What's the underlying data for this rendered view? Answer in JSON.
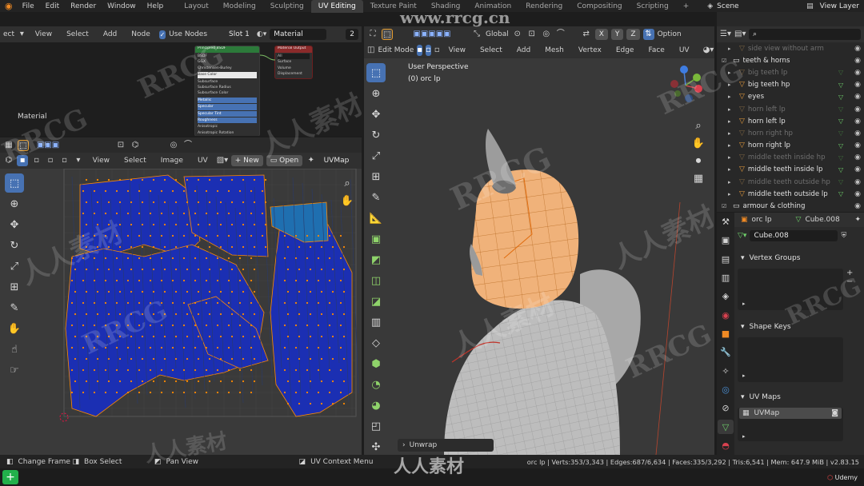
{
  "menubar": {
    "menus": [
      "File",
      "Edit",
      "Render",
      "Window",
      "Help"
    ],
    "workspaces": [
      "Layout",
      "Modeling",
      "Sculpting",
      "UV Editing",
      "Texture Paint",
      "Shading",
      "Animation",
      "Rendering",
      "Compositing",
      "Scripting"
    ],
    "active_workspace": "UV Editing",
    "add_tab": "+",
    "scene": "Scene",
    "view_layer": "View Layer"
  },
  "node_editor": {
    "menus": [
      "ect",
      "View",
      "Select",
      "Add",
      "Node"
    ],
    "use_nodes_label": "Use Nodes",
    "slot": "Slot 1",
    "material": "Material",
    "material_users": "2",
    "frame_label": "Material",
    "bsdf_title": "Principled BSDF",
    "output_title": "Material Output",
    "bsdf_rows": [
      "BSDF",
      "GGX",
      "Christensen-Burley",
      "Base Color",
      "Subsurface",
      "Subsurface Radius",
      "Subsurface Color",
      "Metallic",
      "Specular",
      "Specular Tint",
      "Roughness",
      "Anisotropic",
      "Anisotropic Rotation"
    ],
    "output_rows": [
      "All",
      "Surface",
      "Volume",
      "Displacement"
    ]
  },
  "uv_editor": {
    "menus": [
      "View",
      "Select",
      "Image",
      "UV"
    ],
    "new_label": "New",
    "open_label": "Open",
    "uvmap": "UVMap"
  },
  "viewport": {
    "mode": "Edit Mode",
    "menus": [
      "View",
      "Select",
      "Add",
      "Mesh",
      "Vertex",
      "Edge",
      "Face",
      "UV"
    ],
    "orientation": "Global",
    "options_label": "Option",
    "perspective": "User Perspective",
    "object_label": "(0) orc lp",
    "last_op": "Unwrap",
    "axes": [
      "X",
      "Y",
      "Z"
    ]
  },
  "outliner": {
    "search_placeholder": "",
    "rows": [
      {
        "name": "side view without arm",
        "dim": true,
        "type": "image"
      },
      {
        "name": "teeth & horns",
        "dim": false,
        "type": "collection"
      },
      {
        "name": "big teeth lp",
        "dim": true,
        "type": "mesh"
      },
      {
        "name": "big teeth hp",
        "dim": false,
        "type": "mesh"
      },
      {
        "name": "eyes",
        "dim": false,
        "type": "mesh"
      },
      {
        "name": "horn left lp",
        "dim": true,
        "type": "mesh"
      },
      {
        "name": "horn left lp",
        "dim": false,
        "type": "mesh"
      },
      {
        "name": "horn right hp",
        "dim": true,
        "type": "mesh"
      },
      {
        "name": "horn right lp",
        "dim": false,
        "type": "mesh"
      },
      {
        "name": "middle teeth inside hp",
        "dim": true,
        "type": "mesh"
      },
      {
        "name": "middle teeth inside lp",
        "dim": false,
        "type": "mesh"
      },
      {
        "name": "middle teeth outside hp",
        "dim": true,
        "type": "mesh"
      },
      {
        "name": "middle teeth outside lp",
        "dim": false,
        "type": "mesh"
      },
      {
        "name": "armour & clothing",
        "dim": false,
        "type": "collection"
      }
    ]
  },
  "properties": {
    "object": "orc lp",
    "mesh": "Cube.008",
    "mesh_field": "Cube.008",
    "panels": [
      "Vertex Groups",
      "Shape Keys",
      "UV Maps"
    ],
    "uvmap_item": "UVMap"
  },
  "statusbar": {
    "items": [
      "Change Frame",
      "Box Select",
      "Pan View",
      "UV Context Menu"
    ],
    "stats": "orc lp | Verts:353/3,343 | Edges:687/6,634 | Faces:335/3,292 | Tris:6,541 | Mem: 647.9 MiB | v2.83.15",
    "udemy": "Udemy"
  },
  "watermarks": {
    "rrcg": "RRCG",
    "cn": "人人素材",
    "url": "www.rrcg.cn"
  },
  "colors": {
    "accent": "#4772b3",
    "uv_island": "#1b2fb3",
    "uv_vertex": "#ff8a00",
    "selection": "#f39b34",
    "mesh_base": "#b9b9b9"
  }
}
